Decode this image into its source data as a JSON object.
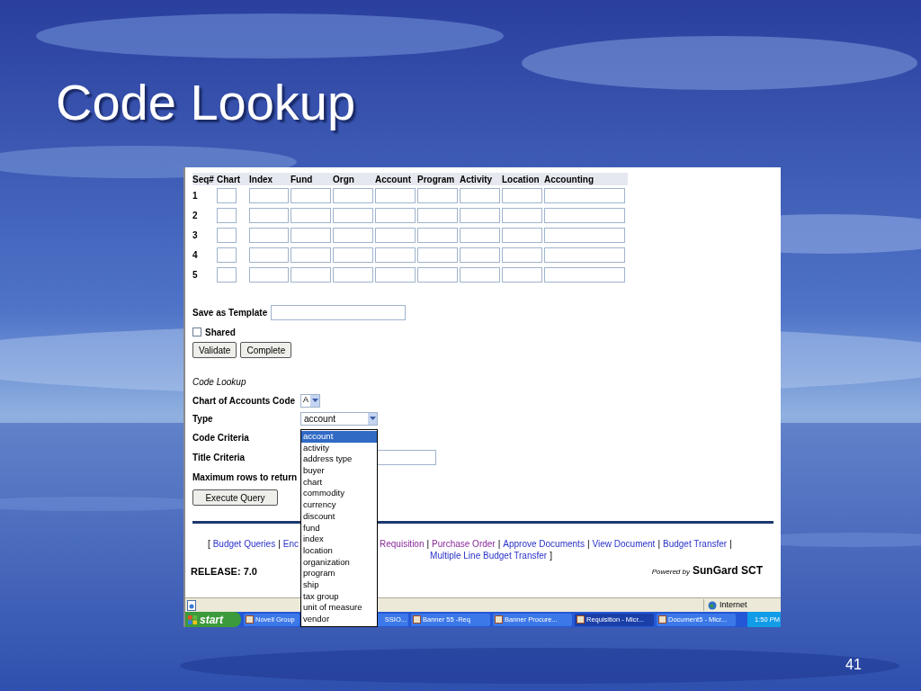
{
  "slide": {
    "title": "Code Lookup",
    "page_number": "41"
  },
  "form": {
    "columns": [
      "Seq#",
      "Chart",
      "Index",
      "Fund",
      "Orgn",
      "Account",
      "Program",
      "Activity",
      "Location",
      "Accounting"
    ],
    "rows": [
      "1",
      "2",
      "3",
      "4",
      "5"
    ],
    "template_label": "Save as Template",
    "shared": {
      "label": "Shared",
      "checked": false
    },
    "buttons": [
      "Validate",
      "Complete"
    ]
  },
  "lookup": {
    "heading": "Code Lookup",
    "chart_label": "Chart of Accounts Code",
    "chart_value": "A",
    "type_label": "Type",
    "type_value": "account",
    "code_label": "Code Criteria",
    "title_label": "Title Criteria",
    "max_label": "Maximum rows to return",
    "execute": "Execute Query",
    "options": [
      {
        "label": "account",
        "selected": true
      },
      {
        "label": "activity",
        "selected": false
      },
      {
        "label": "address type",
        "selected": false
      },
      {
        "label": "buyer",
        "selected": false
      },
      {
        "label": "chart",
        "selected": false
      },
      {
        "label": "commodity",
        "selected": false
      },
      {
        "label": "currency",
        "selected": false
      },
      {
        "label": "discount",
        "selected": false
      },
      {
        "label": "fund",
        "selected": false
      },
      {
        "label": "index",
        "selected": false
      },
      {
        "label": "location",
        "selected": false
      },
      {
        "label": "organization",
        "selected": false
      },
      {
        "label": "program",
        "selected": false
      },
      {
        "label": "ship",
        "selected": false
      },
      {
        "label": "tax group",
        "selected": false
      },
      {
        "label": "unit of measure",
        "selected": false
      },
      {
        "label": "vendor",
        "selected": false
      }
    ]
  },
  "footer": {
    "open_bracket": "[",
    "close_bracket": "]",
    "separator": "|",
    "links_left": [
      {
        "label": "Budget Queries",
        "visited": false
      },
      {
        "label": "Enc",
        "visited": false
      }
    ],
    "links_right": [
      {
        "label": "Requisition",
        "visited": true
      },
      {
        "label": "Purchase Order",
        "visited": true
      },
      {
        "label": "Approve Documents",
        "visited": false
      },
      {
        "label": "View Document",
        "visited": false
      },
      {
        "label": "Budget Transfer",
        "visited": false
      }
    ],
    "links_second_line": [
      {
        "label": "Multiple Line Budget Transfer",
        "visited": false
      }
    ],
    "release": "RELEASE: 7.0",
    "powered_by": "Powered by",
    "brand": "SunGard SCT"
  },
  "status_bar": {
    "zone": "Internet"
  },
  "taskbar": {
    "start": "start",
    "items": [
      {
        "label": "Novell Group",
        "active": false
      },
      {
        "label": "SSIO...",
        "active": false
      },
      {
        "label": "Banner 55 -Req",
        "active": false
      },
      {
        "label": "Banner Procure...",
        "active": false
      },
      {
        "label": "Requisition - Micr...",
        "active": true
      },
      {
        "label": "Document5 - Micr...",
        "active": false
      }
    ],
    "clock": "1:50 PM"
  }
}
